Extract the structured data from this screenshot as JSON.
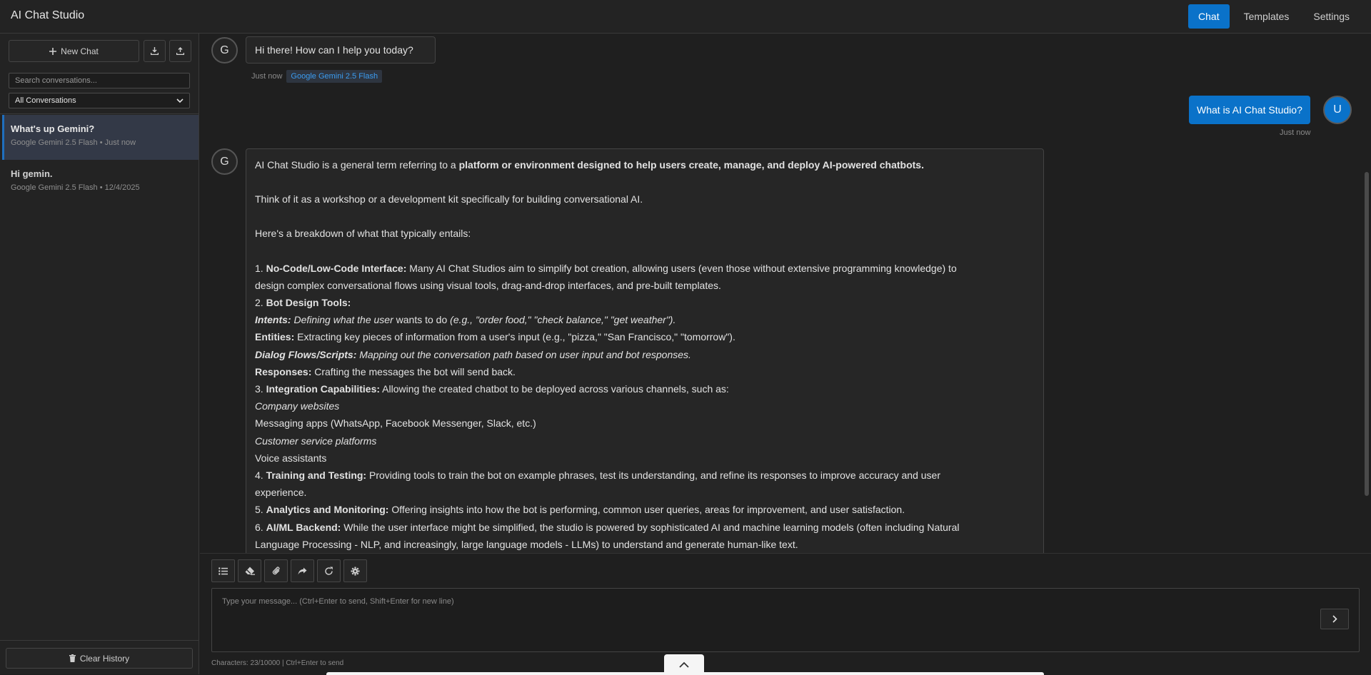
{
  "app": {
    "title": "AI Chat Studio"
  },
  "nav": {
    "items": [
      "Chat",
      "Templates",
      "Settings"
    ],
    "active": "Chat"
  },
  "sidebar": {
    "new_chat_label": "New Chat",
    "search_placeholder": "Search conversations...",
    "filter_value": "All Conversations",
    "conversations": [
      {
        "title": "What's up Gemini?",
        "subtitle": "Google Gemini 2.5 Flash • Just now",
        "active": true
      },
      {
        "title": "Hi gemin.",
        "subtitle": "Google Gemini 2.5 Flash • 12/4/2025",
        "active": false
      }
    ],
    "clear_history_label": "Clear History"
  },
  "messages": {
    "m1": {
      "avatar": "G",
      "text": "Hi there! How can I help you today?",
      "time": "Just now",
      "model": "Google Gemini 2.5 Flash"
    },
    "m2": {
      "avatar": "U",
      "text": "What is AI Chat Studio?",
      "time": "Just now"
    },
    "m3": {
      "avatar": "G",
      "p1_a": "AI Chat Studio is a general term referring to a ",
      "p1_b": "platform or environment designed to help users create, manage, and deploy AI-powered chatbots.",
      "p2": "Think of it as a workshop or a development kit specifically for building conversational AI.",
      "p3": "Here's a breakdown of what that typically entails:",
      "l1_num": "1. ",
      "l1_b": "No-Code/Low-Code Interface:",
      "l1_t": " Many AI Chat Studios aim to simplify bot creation, allowing users (even those without extensive programming knowledge) to",
      "l1_t2": "design complex conversational flows using visual tools, drag-and-drop interfaces, and pre-built templates.",
      "l2_num": "2. ",
      "l2_b": "Bot Design Tools:",
      "l3_b": "Intents:",
      "l3_i": " Defining what the user",
      "l3_t": " wants to do ",
      "l3_i2": "(e.g., \"order food,\" \"check balance,\" \"get weather\").",
      "l4_b": "Entities:",
      "l4_t": " Extracting key pieces of information from a user's input (e.g., \"pizza,\" \"San Francisco,\" \"tomorrow\").",
      "l5_b": "Dialog Flows/Scripts:",
      "l5_i": " Mapping out the conversation path based on user input and bot responses.",
      "l6_b": "Responses:",
      "l6_t": " Crafting the messages the bot will send back.",
      "l7_num": "3. ",
      "l7_b": "Integration Capabilities:",
      "l7_t": " Allowing the created chatbot to be deployed across various channels, such as:",
      "l8_i": "Company websites",
      "l9": "Messaging apps (WhatsApp, Facebook Messenger, Slack, etc.)",
      "l10_i": "Customer service platforms",
      "l11": "Voice assistants",
      "l12_num": "4. ",
      "l12_b": "Training and Testing:",
      "l12_t": " Providing tools to train the bot on example phrases, test its understanding, and refine its responses to improve accuracy and user",
      "l12_t2": "experience.",
      "l13_num": "5. ",
      "l13_b": "Analytics and Monitoring:",
      "l13_t": " Offering insights into how the bot is performing, common user queries, areas for improvement, and user satisfaction.",
      "l14_num": "6. ",
      "l14_b": "AI/ML Backend:",
      "l14_t": " While the user interface might be simplified, the studio is powered by sophisticated AI and machine learning models (often including Natural",
      "l14_t2": "Language Processing - NLP, and increasingly, large language models - LLMs) to understand and generate human-like text."
    }
  },
  "composer": {
    "placeholder": "Type your message... (Ctrl+Enter to send, Shift+Enter for new line)",
    "counter": "Characters: 23/10000 | Ctrl+Enter to send",
    "tools": [
      "list-icon",
      "eraser-icon",
      "paperclip-icon",
      "share-icon",
      "refresh-icon",
      "gear-icon"
    ]
  },
  "colors": {
    "accent": "#0a72c9",
    "background": "#1f1f1f",
    "panel": "#232323",
    "model_tag": "#3b9cf0"
  }
}
